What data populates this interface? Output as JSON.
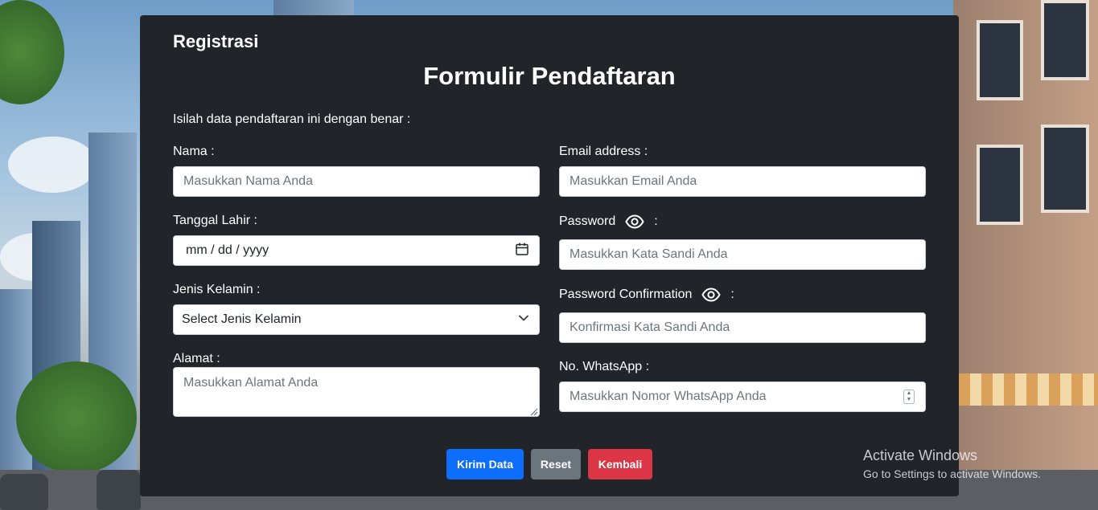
{
  "brand": "Registrasi",
  "title": "Formulir Pendaftaran",
  "intro": "Isilah data pendaftaran ini dengan benar :",
  "form": {
    "nama": {
      "label": "Nama :",
      "placeholder": "Masukkan Nama Anda"
    },
    "tanggal_lahir": {
      "label": "Tanggal Lahir :",
      "value": "mm / dd / yyyy",
      "icon": "calendar-icon"
    },
    "jenis_kelamin": {
      "label": "Jenis Kelamin :",
      "selected": "Select Jenis Kelamin",
      "icon": "chevron-down-icon"
    },
    "alamat": {
      "label": "Alamat :",
      "placeholder": "Masukkan Alamat Anda"
    },
    "email": {
      "label": "Email address :",
      "placeholder": "Masukkan Email Anda"
    },
    "password": {
      "label": "Password",
      "suffix": ":",
      "placeholder": "Masukkan Kata Sandi Anda",
      "icon": "eye-icon"
    },
    "password_confirmation": {
      "label": "Password Confirmation",
      "suffix": ":",
      "placeholder": "Konfirmasi Kata Sandi Anda",
      "icon": "eye-icon"
    },
    "whatsapp": {
      "label": "No. WhatsApp :",
      "placeholder": "Masukkan Nomor WhatsApp Anda"
    }
  },
  "buttons": {
    "submit": {
      "label": "Kirim Data",
      "color": "#0d6efd"
    },
    "reset": {
      "label": "Reset",
      "color": "#6c757d"
    },
    "back": {
      "label": "Kembali",
      "color": "#dc3545"
    }
  },
  "watermark": {
    "title": "Activate Windows",
    "subtitle": "Go to Settings to activate Windows."
  }
}
